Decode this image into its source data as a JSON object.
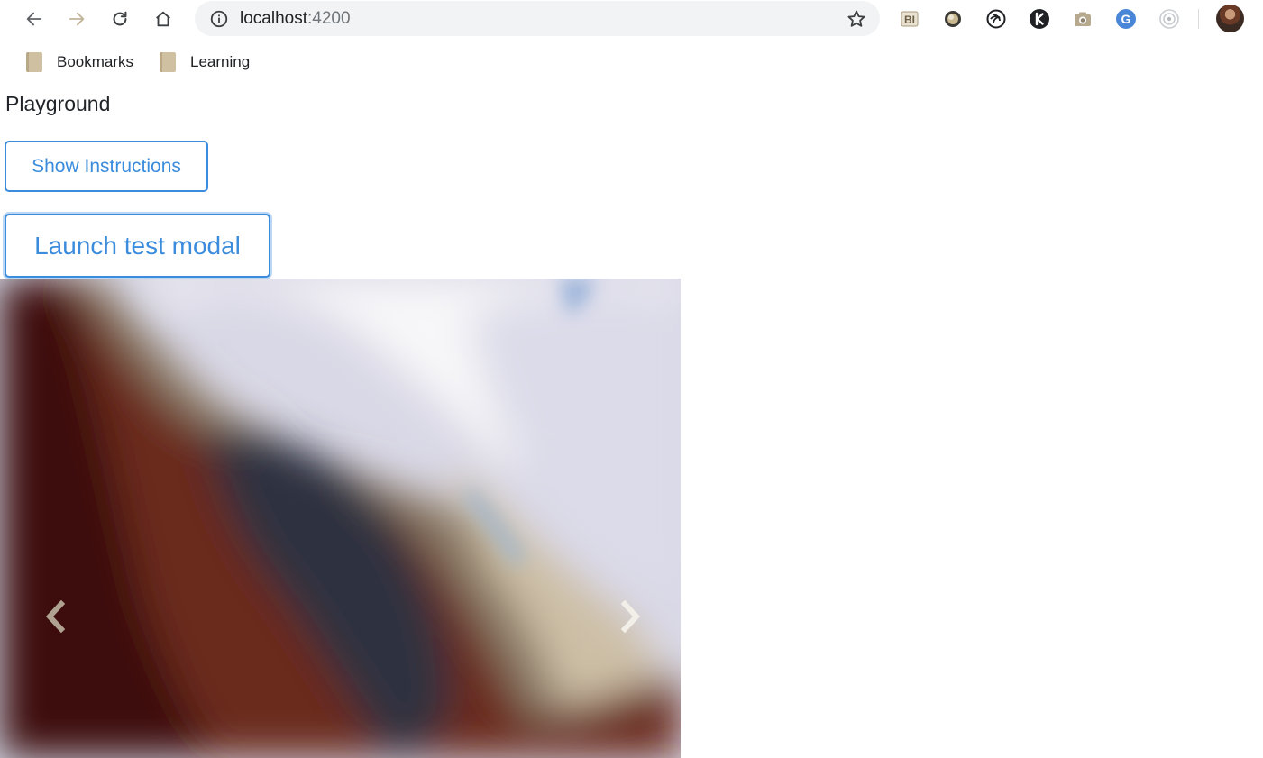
{
  "browser": {
    "url_host": "localhost",
    "url_port": ":4200",
    "nav_icons": [
      "back-arrow-icon",
      "forward-arrow-icon",
      "reload-icon",
      "home-icon"
    ],
    "extension_icons": [
      "bi-extension-icon",
      "circle-extension-icon",
      "spiral-extension-icon",
      "k-extension-icon",
      "camera-extension-icon",
      "google-g-extension-icon",
      "target-extension-icon"
    ]
  },
  "bookmarks": [
    {
      "label": "Bookmarks"
    },
    {
      "label": "Learning"
    }
  ],
  "page": {
    "title": "Playground",
    "show_instructions_label": "Show Instructions",
    "launch_modal_label": "Launch test modal"
  },
  "carousel": {
    "prev_icon": "chevron-left-icon",
    "next_icon": "chevron-right-icon"
  },
  "colors": {
    "accent": "#3b8cdc",
    "omnibox_bg": "#f1f3f4"
  }
}
